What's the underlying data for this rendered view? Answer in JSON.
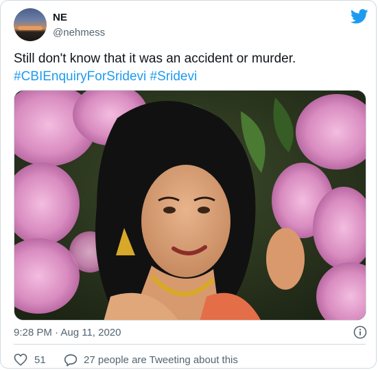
{
  "user": {
    "name": "NE",
    "handle": "@nehmess"
  },
  "tweet": {
    "text": "Still don't know that it was an accident or murder.",
    "hashtags": [
      "#CBIEnquiryForSridevi",
      "#Sridevi"
    ],
    "timestamp": "9:28 PM · Aug 11, 2020"
  },
  "engagement": {
    "likes": "51",
    "replies_text": "27 people are Tweeting about this"
  },
  "icons": {
    "brand": "twitter-bird-icon",
    "info": "info-icon",
    "like": "heart-icon",
    "reply": "speech-bubble-icon"
  },
  "colors": {
    "accent": "#1d9bf0",
    "text": "#0f1419",
    "muted": "#536471",
    "border": "#cfd9de"
  }
}
